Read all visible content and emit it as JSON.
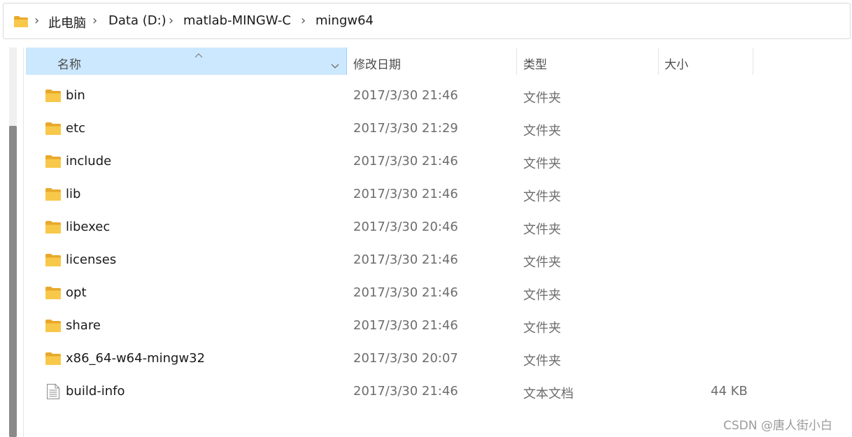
{
  "breadcrumb": {
    "items": [
      "此电脑",
      "Data (D:)",
      "matlab-MINGW-C",
      "mingw64"
    ],
    "separator": "›"
  },
  "columns": {
    "name": "名称",
    "date": "修改日期",
    "type": "类型",
    "size": "大小"
  },
  "files": [
    {
      "name": "bin",
      "date": "2017/3/30 21:46",
      "type": "文件夹",
      "size": "",
      "icon": "folder-icon"
    },
    {
      "name": "etc",
      "date": "2017/3/30 21:29",
      "type": "文件夹",
      "size": "",
      "icon": "folder-icon"
    },
    {
      "name": "include",
      "date": "2017/3/30 21:46",
      "type": "文件夹",
      "size": "",
      "icon": "folder-icon"
    },
    {
      "name": "lib",
      "date": "2017/3/30 21:46",
      "type": "文件夹",
      "size": "",
      "icon": "folder-icon"
    },
    {
      "name": "libexec",
      "date": "2017/3/30 20:46",
      "type": "文件夹",
      "size": "",
      "icon": "folder-icon"
    },
    {
      "name": "licenses",
      "date": "2017/3/30 21:46",
      "type": "文件夹",
      "size": "",
      "icon": "folder-icon"
    },
    {
      "name": "opt",
      "date": "2017/3/30 21:46",
      "type": "文件夹",
      "size": "",
      "icon": "folder-icon"
    },
    {
      "name": "share",
      "date": "2017/3/30 21:46",
      "type": "文件夹",
      "size": "",
      "icon": "folder-icon"
    },
    {
      "name": "x86_64-w64-mingw32",
      "date": "2017/3/30 20:07",
      "type": "文件夹",
      "size": "",
      "icon": "folder-icon"
    },
    {
      "name": "build-info",
      "date": "2017/3/30 21:46",
      "type": "文本文档",
      "size": "44 KB",
      "icon": "text-file-icon"
    }
  ],
  "watermark": "CSDN @唐人街小白",
  "colors": {
    "folder": "#f8c84a",
    "header_selected": "#cce8ff",
    "secondary_text": "#6d6d6d"
  }
}
